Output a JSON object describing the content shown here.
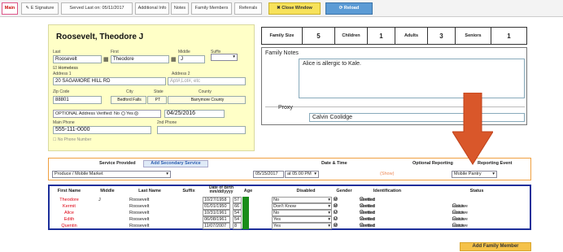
{
  "tabs": {
    "main": "Main",
    "esignature": "E Signature",
    "served": "Served Last on: 05/11/2017",
    "additional": "Additional Info",
    "notes": "Notes",
    "family": "Family Members",
    "referrals": "Referrals",
    "close": "Close Window",
    "reload": "Reload"
  },
  "client": {
    "name": "Roosevelt, Theodore J",
    "last_label": "Last",
    "first_label": "First",
    "middle_label": "Middle",
    "suffix_label": "Suffix",
    "last": "Roosevelt",
    "first": "Theodore",
    "middle": "J",
    "suffix": "",
    "homeless": "Homeless",
    "address1_label": "Address 1",
    "address2_label": "Address 2",
    "address1": "20 SAGAMORE HILL RD",
    "address2_placeholder": "Apt#,Lot#, etc",
    "zip_label": "Zip Code",
    "city_label": "City",
    "state_label": "State",
    "county_label": "County",
    "zip": "88801",
    "city": "Bedford Falls",
    "state": "PT",
    "county": "Barrymore County",
    "optional": "OPTIONAL",
    "addr_verified": "Address Verified:",
    "no": "No",
    "yes": "Yes",
    "verified_date": "04/25/2016",
    "main_phone_label": "Main Phone",
    "phone2_label": "2nd Phone",
    "main_phone": "555-111-0000",
    "phone2": "",
    "no_phone": "No Phone Number"
  },
  "family": {
    "size_label": "Family Size",
    "size": "5",
    "children_label": "Children",
    "children": "1",
    "adults_label": "Adults",
    "adults": "3",
    "seniors_label": "Seniors",
    "seniors": "1",
    "notes_label": "Family Notes",
    "notes": "Alice is allergic to Kale.",
    "proxy_label": "Proxy",
    "proxy": "Calvin Coolidge"
  },
  "service": {
    "provided_label": "Service Provided",
    "add_secondary": "Add Secondary Service",
    "date_label": "Date & Time",
    "optional_label": "Optional Reporting",
    "event_label": "Reporting Event",
    "service_value": "Produce / Mobile Market",
    "date": "05/15/2017",
    "time": "at 05:00 PM",
    "show": "(Show)",
    "event_value": "Mobile Pantry"
  },
  "members": {
    "headers": [
      "First Name",
      "Middle",
      "Last Name",
      "Suffix",
      "Date of Birth mm/dd/yyyy",
      "Age",
      "Disabled",
      "Gender",
      "Identification",
      "Status"
    ],
    "rows": [
      {
        "first": "Theodore",
        "middle": "J",
        "last": "Roosevelt",
        "suffix": "",
        "dob": "10/27/1958",
        "age": "57",
        "disabled": "No",
        "gender": "M",
        "id": "Verified",
        "status": ""
      },
      {
        "first": "Kermit",
        "middle": "",
        "last": "Roosevelt",
        "suffix": "",
        "dob": "01/01/1950",
        "age": "66",
        "disabled": "Don't Know",
        "gender": "M",
        "id": "Verified",
        "status": "Active"
      },
      {
        "first": "Alice",
        "middle": "",
        "last": "Roosevelt",
        "suffix": "",
        "dob": "10/31/1961",
        "age": "54",
        "disabled": "No",
        "gender": "F",
        "id": "Verified",
        "status": "Active"
      },
      {
        "first": "Edith",
        "middle": "",
        "last": "Roosevelt",
        "suffix": "",
        "dob": "06/08/1961",
        "age": "54",
        "disabled": "Yes",
        "gender": "F",
        "id": "Verified",
        "status": "Active"
      },
      {
        "first": "Quentin",
        "middle": "",
        "last": "Roosevelt",
        "suffix": "",
        "dob": "11/07/2007",
        "age": "8",
        "disabled": "Yes",
        "gender": "M",
        "id": "Verified",
        "status": "Active"
      }
    ],
    "f": "F",
    "m": "M",
    "needed": "Needed",
    "verified": "Verified",
    "active": "Active",
    "inactive": "Inactive",
    "add_button": "Add Family Member"
  },
  "colors": {
    "arrow": "#d9572a",
    "accent_border": "#f0a040",
    "member_border": "#1d2f9a"
  }
}
